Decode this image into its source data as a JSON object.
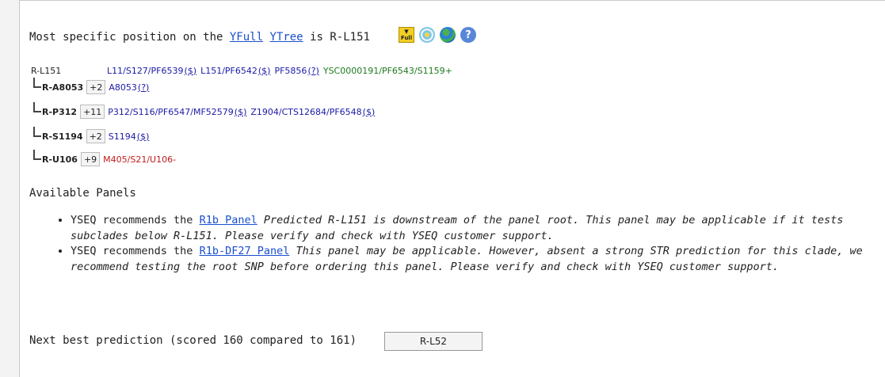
{
  "position": {
    "prefix": "Most specific position on the",
    "yfull_link": "YFull",
    "ytree_link": "YTree",
    "suffix": "is R-L151",
    "badge_top": "▼",
    "badge_bottom": "Full"
  },
  "icons": [
    "yfull-badge-icon",
    "ytree-swirl-icon",
    "globe-icon",
    "help-icon"
  ],
  "help_glyph": "?",
  "tree": {
    "root": {
      "node": "R-L151",
      "snps": [
        {
          "text": "L11/S127/PF6539",
          "color": "blue"
        },
        {
          "text": "($)",
          "color": "blue",
          "link": true
        },
        {
          "text": "L151/PF6542",
          "color": "blue"
        },
        {
          "text": "($)",
          "color": "blue",
          "link": true
        },
        {
          "text": "PF5856",
          "color": "blue"
        },
        {
          "text": "(?)",
          "color": "blue",
          "link": true
        },
        {
          "text": "YSC0000191/PF6543/S1159+",
          "color": "green"
        }
      ]
    },
    "children": [
      {
        "node": "R-A8053",
        "count": "+2",
        "snps": [
          {
            "text": "A8053",
            "color": "blue"
          },
          {
            "text": "(?)",
            "color": "blue",
            "link": true
          }
        ]
      },
      {
        "node": "R-P312",
        "count": "+11",
        "snps": [
          {
            "text": "P312/S116/PF6547/MF52579",
            "color": "blue"
          },
          {
            "text": "($)",
            "color": "blue",
            "link": true
          },
          {
            "text": "Z1904/CTS12684/PF6548",
            "color": "blue"
          },
          {
            "text": "($)",
            "color": "blue",
            "link": true
          }
        ]
      },
      {
        "node": "R-S1194",
        "count": "+2",
        "snps": [
          {
            "text": "S1194",
            "color": "blue"
          },
          {
            "text": "($)",
            "color": "blue",
            "link": true
          }
        ]
      },
      {
        "node": "R-U106",
        "count": "+9",
        "snps": [
          {
            "text": "M405/S21/U106-",
            "color": "red"
          }
        ]
      }
    ]
  },
  "available_panels": {
    "title": "Available Panels",
    "items": [
      {
        "prefix": "YSEQ recommends the",
        "link": "R1b Panel",
        "note": "Predicted R-L151 is downstream of the panel root. This panel may be applicable if it tests subclades below R-L151. Please verify and check with YSEQ customer support."
      },
      {
        "prefix": "YSEQ recommends the",
        "link": "R1b-DF27 Panel",
        "note": "This panel may be applicable. However, absent a strong STR prediction for this clade, we recommend testing the root SNP before ordering this panel. Please verify and check with YSEQ customer support."
      }
    ]
  },
  "next_best": {
    "label": "Next best prediction (scored 160 compared to 161)",
    "value": "R-L52"
  }
}
